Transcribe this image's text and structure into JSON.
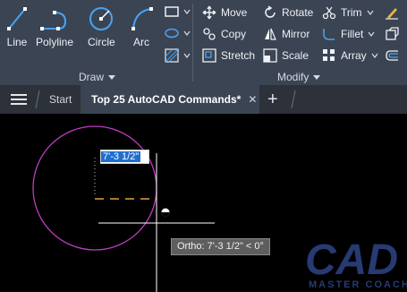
{
  "ribbon": {
    "draw_panel": {
      "title": "Draw",
      "tools": [
        {
          "label": "Line",
          "icon": "line-icon"
        },
        {
          "label": "Polyline",
          "icon": "polyline-icon"
        },
        {
          "label": "Circle",
          "icon": "circle-icon"
        },
        {
          "label": "Arc",
          "icon": "arc-icon"
        }
      ]
    },
    "modify_panel": {
      "title": "Modify",
      "tools": [
        {
          "label": "Move",
          "icon": "move-icon"
        },
        {
          "label": "Rotate",
          "icon": "rotate-icon"
        },
        {
          "label": "Trim",
          "icon": "trim-icon"
        },
        {
          "label": "Copy",
          "icon": "copy-icon"
        },
        {
          "label": "Mirror",
          "icon": "mirror-icon"
        },
        {
          "label": "Fillet",
          "icon": "fillet-icon"
        },
        {
          "label": "Stretch",
          "icon": "stretch-icon"
        },
        {
          "label": "Scale",
          "icon": "scale-icon"
        },
        {
          "label": "Array",
          "icon": "array-icon"
        }
      ]
    }
  },
  "tabs": {
    "start": "Start",
    "document": "Top 25 AutoCAD Commands*",
    "close_symbol": "✕",
    "new_tab_symbol": "+"
  },
  "canvas": {
    "dynamic_input_value": "7'-3 1/2\"",
    "tooltip": "Ortho: 7'-3 1/2\" < 0°",
    "watermark_text": "CAD MASTER COACH"
  },
  "colors": {
    "ribbon_bg": "#3b4453",
    "tabbar_bg": "#2c313a",
    "circle_stroke": "#c03cc0",
    "accent_blue": "#4aa3f0",
    "dim_orange": "#e0a040",
    "watermark": "#273a73"
  }
}
